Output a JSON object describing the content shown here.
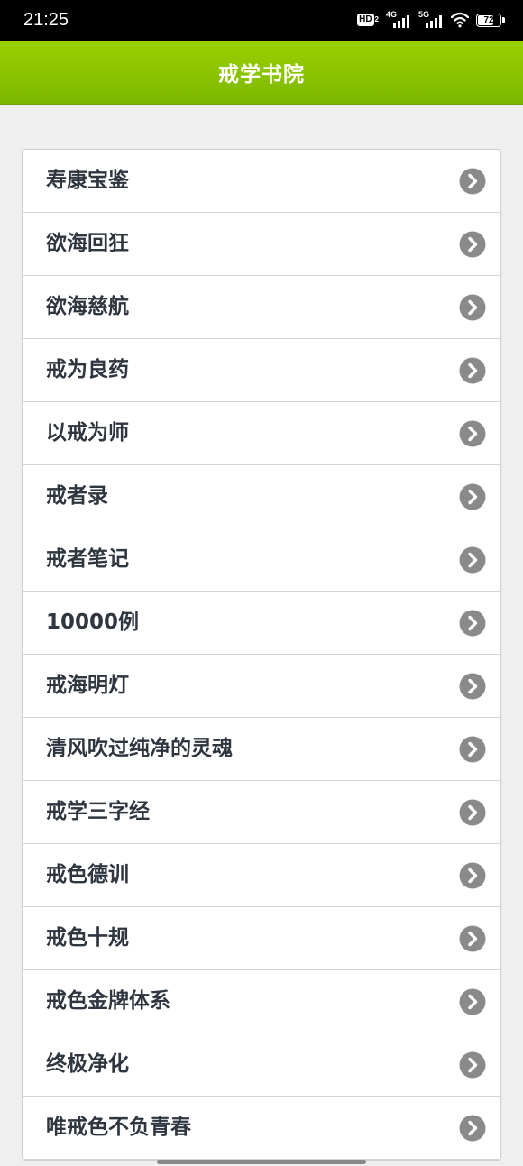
{
  "status_bar": {
    "time": "21:25",
    "hd_label": "HD",
    "hd_sub": "2",
    "signal_1_label": "4G",
    "signal_2_label": "5G",
    "battery_level": "72",
    "icons": [
      "hd-icon",
      "signal-icon",
      "signal-icon",
      "wifi-icon",
      "battery-icon"
    ]
  },
  "header": {
    "title": "戒学书院",
    "background": "#8cc400"
  },
  "list": {
    "chevron_icon": "chevron-right-circle-icon",
    "items": [
      {
        "label": "寿康宝鉴"
      },
      {
        "label": "欲海回狂"
      },
      {
        "label": "欲海慈航"
      },
      {
        "label": "戒为良药"
      },
      {
        "label": "以戒为师"
      },
      {
        "label": "戒者录"
      },
      {
        "label": "戒者笔记"
      },
      {
        "label": "10000例"
      },
      {
        "label": "戒海明灯"
      },
      {
        "label": "清风吹过纯净的灵魂"
      },
      {
        "label": "戒学三字经"
      },
      {
        "label": "戒色德训"
      },
      {
        "label": "戒色十规"
      },
      {
        "label": "戒色金牌体系"
      },
      {
        "label": "终极净化"
      },
      {
        "label": "唯戒色不负青春"
      }
    ]
  }
}
